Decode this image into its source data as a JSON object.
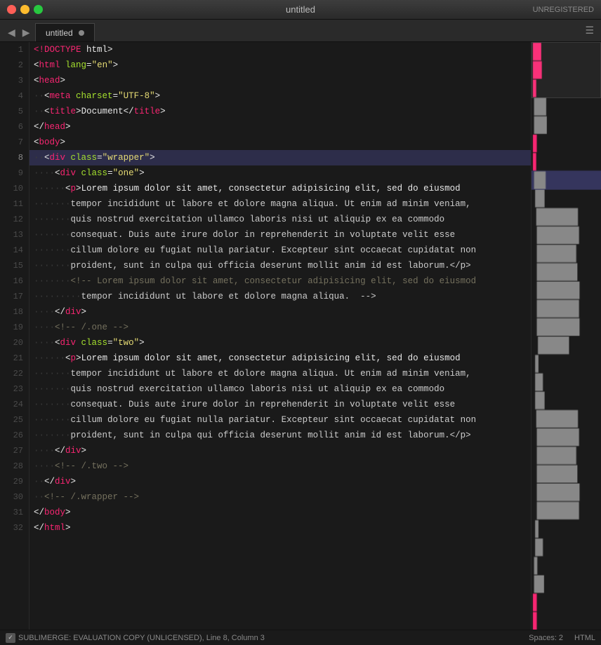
{
  "titlebar": {
    "title": "untitled",
    "unregistered": "UNREGISTERED"
  },
  "tab": {
    "name": "untitled",
    "language": "HTML"
  },
  "statusbar": {
    "left": "SUBLIMERGE: EVALUATION COPY (UNLICENSED), Line 8, Column 3",
    "spaces": "Spaces: 2",
    "language": "HTML"
  },
  "lines": [
    {
      "num": 1,
      "indent": "",
      "tokens": [
        {
          "t": "doctype",
          "v": "<!DOCTYPE"
        },
        {
          "t": "plain",
          "v": " "
        },
        {
          "t": "plain",
          "v": "html"
        }
      ],
      "raw": "<!DOCTYPE html>"
    },
    {
      "num": 2,
      "indent": "",
      "tokens": [],
      "raw": "<html lang=\"en\">"
    },
    {
      "num": 3,
      "indent": "",
      "tokens": [],
      "raw": "<head>"
    },
    {
      "num": 4,
      "indent": "··",
      "tokens": [],
      "raw": "··<meta charset=\"UTF-8\">"
    },
    {
      "num": 5,
      "indent": "··",
      "tokens": [],
      "raw": "··<title>Document</title>"
    },
    {
      "num": 6,
      "indent": "",
      "tokens": [],
      "raw": "</head>"
    },
    {
      "num": 7,
      "indent": "",
      "tokens": [],
      "raw": "<body>"
    },
    {
      "num": 8,
      "indent": "··",
      "tokens": [],
      "raw": "··<div class=\"wrapper\">",
      "highlighted": true,
      "bookmark": true
    },
    {
      "num": 9,
      "indent": "····",
      "tokens": [],
      "raw": "····<div class=\"one\">"
    },
    {
      "num": 10,
      "indent": "······",
      "tokens": [],
      "raw": "······<p>Lorem ipsum dolor sit amet, consectetur adipisicing elit, sed do eiusmod"
    },
    {
      "num": 11,
      "indent": "·······",
      "tokens": [],
      "raw": "·······tempor incididunt ut labore et dolore magna aliqua. Ut enim ad minim veniam,"
    },
    {
      "num": 12,
      "indent": "·······",
      "tokens": [],
      "raw": "·······quis nostrud exercitation ullamco laboris nisi ut aliquip ex ea commodo"
    },
    {
      "num": 13,
      "indent": "·······",
      "tokens": [],
      "raw": "·······consequat. Duis aute irure dolor in reprehenderit in voluptate velit esse"
    },
    {
      "num": 14,
      "indent": "·······",
      "tokens": [],
      "raw": "·······cillum dolore eu fugiat nulla pariatur. Excepteur sint occaecat cupidatat non"
    },
    {
      "num": 15,
      "indent": "·······",
      "tokens": [],
      "raw": "·······proident, sunt in culpa qui officia deserunt mollit anim id est laborum.</p>"
    },
    {
      "num": 16,
      "indent": "·······",
      "tokens": [],
      "raw": "·······<!-- Lorem ipsum dolor sit amet, consectetur adipisicing elit, sed do eiusmod"
    },
    {
      "num": 17,
      "indent": "·········",
      "tokens": [],
      "raw": "·········tempor incididunt ut labore et dolore magna aliqua.  -->"
    },
    {
      "num": 18,
      "indent": "····",
      "tokens": [],
      "raw": "····</div>"
    },
    {
      "num": 19,
      "indent": "····",
      "tokens": [],
      "raw": "····<!-- /.one -->"
    },
    {
      "num": 20,
      "indent": "····",
      "tokens": [],
      "raw": "····<div class=\"two\">"
    },
    {
      "num": 21,
      "indent": "······",
      "tokens": [],
      "raw": "······<p>Lorem ipsum dolor sit amet, consectetur adipisicing elit, sed do eiusmod"
    },
    {
      "num": 22,
      "indent": "·······",
      "tokens": [],
      "raw": "·······tempor incididunt ut labore et dolore magna aliqua. Ut enim ad minim veniam,"
    },
    {
      "num": 23,
      "indent": "·······",
      "tokens": [],
      "raw": "·······quis nostrud exercitation ullamco laboris nisi ut aliquip ex ea commodo"
    },
    {
      "num": 24,
      "indent": "·······",
      "tokens": [],
      "raw": "·······consequat. Duis aute irure dolor in reprehenderit in voluptate velit esse"
    },
    {
      "num": 25,
      "indent": "·······",
      "tokens": [],
      "raw": "·······cillum dolore eu fugiat nulla pariatur. Excepteur sint occaecat cupidatat non"
    },
    {
      "num": 26,
      "indent": "·······",
      "tokens": [],
      "raw": "·······proident, sunt in culpa qui officia deserunt mollit anim id est laborum.</p>"
    },
    {
      "num": 27,
      "indent": "····",
      "tokens": [],
      "raw": "····</div>"
    },
    {
      "num": 28,
      "indent": "····",
      "tokens": [],
      "raw": "····<!-- /.two -->"
    },
    {
      "num": 29,
      "indent": "··",
      "tokens": [],
      "raw": "··</div>",
      "bookmark": true
    },
    {
      "num": 30,
      "indent": "··",
      "tokens": [],
      "raw": "··<!-- /.wrapper -->"
    },
    {
      "num": 31,
      "indent": "",
      "tokens": [],
      "raw": "</body>"
    },
    {
      "num": 32,
      "indent": "",
      "tokens": [],
      "raw": "</html>"
    }
  ],
  "colors": {
    "bg": "#1a1a1a",
    "gutter_bg": "#1a1a1a",
    "highlight": "#2d2d4a",
    "tag": "#f92672",
    "attr": "#a6e22e",
    "string": "#e6db74",
    "comment": "#75715e",
    "text": "#e8e8e8",
    "doctype": "#f92672",
    "dots": "#404040"
  }
}
